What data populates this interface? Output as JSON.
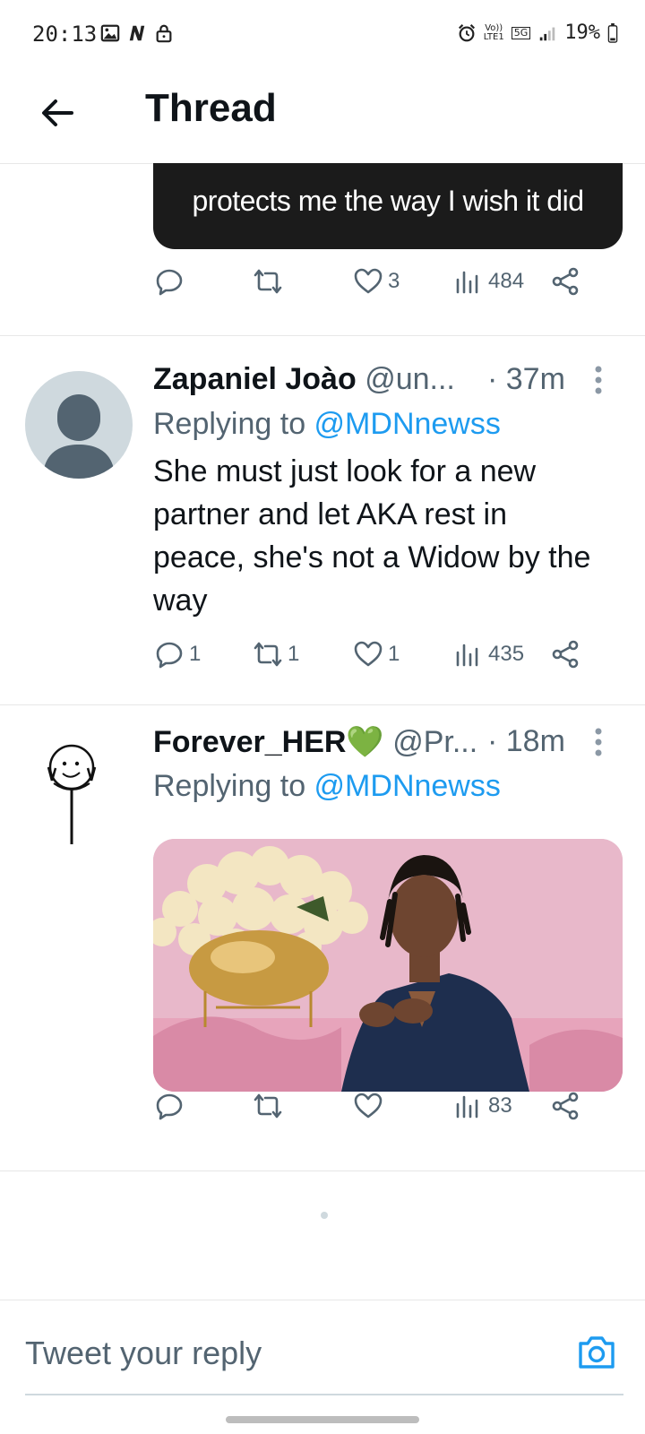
{
  "status_bar": {
    "time": "20:13",
    "net_top": "Vo))",
    "net_bottom": "LTE1",
    "net_5g": "5G",
    "battery": "19%"
  },
  "header": {
    "title": "Thread"
  },
  "tweets": [
    {
      "media_caption": "protects me the way I wish it did",
      "actions": {
        "replies": "",
        "retweets": "",
        "likes": "3",
        "views": "484"
      }
    },
    {
      "name": "Zapaniel Joào",
      "handle": "@un...",
      "time": "· 37m",
      "replying_prefix": "Replying to ",
      "replying_to": "@MDNnewss",
      "text": "She must just look for a new partner and let AKA rest in peace, she's not a Widow by the way",
      "actions": {
        "replies": "1",
        "retweets": "1",
        "likes": "1",
        "views": "435"
      }
    },
    {
      "name": "Forever_HER💚",
      "handle": "@Pr...",
      "time": "· 18m",
      "replying_prefix": "Replying to ",
      "replying_to": "@MDNnewss",
      "actions": {
        "replies": "",
        "retweets": "",
        "likes": "",
        "views": "83"
      }
    }
  ],
  "compose": {
    "placeholder": "Tweet your reply"
  },
  "colors": {
    "accent": "#1d9bf0",
    "secondary_text": "#536471"
  }
}
